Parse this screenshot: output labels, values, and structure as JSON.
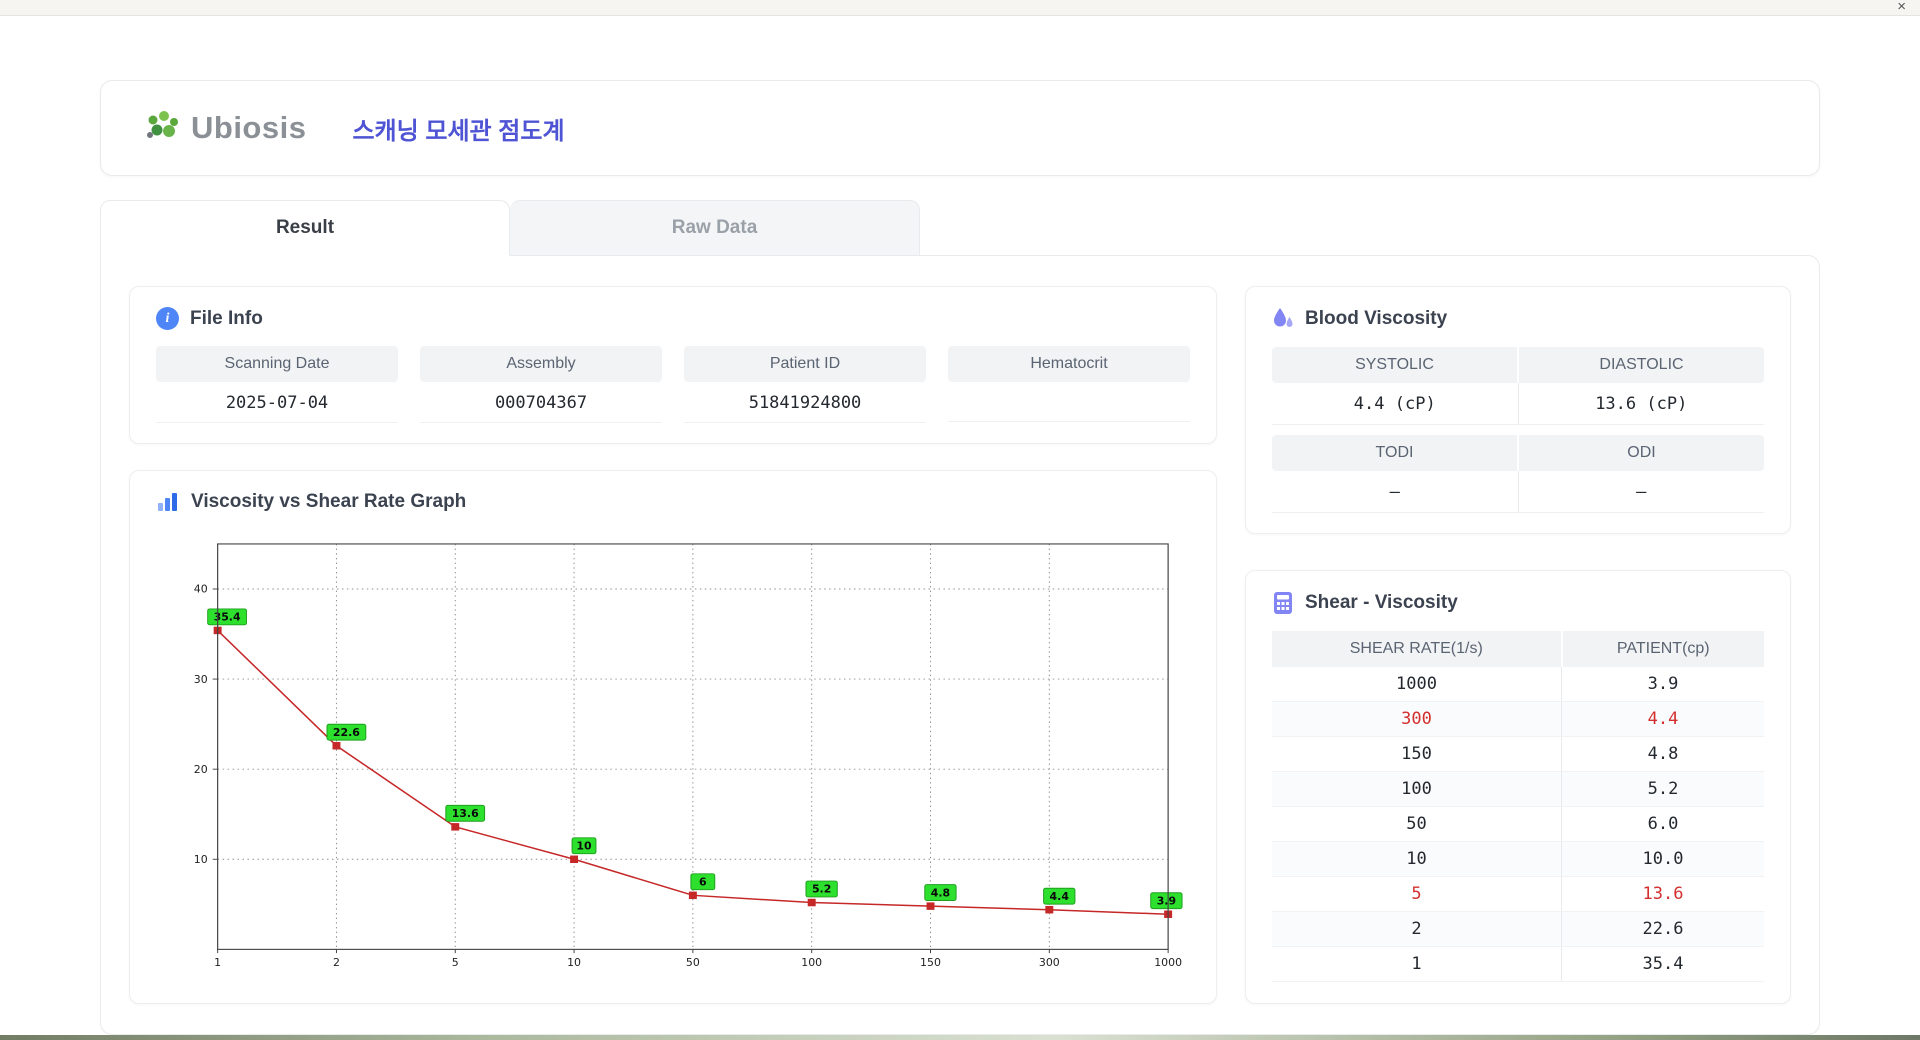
{
  "window": {
    "close_glyph": "×"
  },
  "header": {
    "logo_text": "Ubiosis",
    "title": "스캐닝 모세관 점도계"
  },
  "tabs": [
    {
      "label": "Result"
    },
    {
      "label": "Raw Data"
    }
  ],
  "icons": {
    "info_glyph": "i"
  },
  "colors": {
    "title_blue": "#4e54d4",
    "icon_blue": "#4f86f7",
    "icon_indigo": "#8285f4",
    "highlight_red": "#d32f2f",
    "chart_line_red": "#c62828",
    "chart_label_green": "#2ee02e",
    "header_gray": "#f1f3f5"
  },
  "file_info": {
    "title": "File Info",
    "fields": [
      {
        "label": "Scanning Date",
        "value": "2025-07-04"
      },
      {
        "label": "Assembly",
        "value": "000704367"
      },
      {
        "label": "Patient ID",
        "value": "51841924800"
      },
      {
        "label": "Hematocrit",
        "value": ""
      }
    ]
  },
  "blood_viscosity": {
    "title": "Blood Viscosity",
    "rows": [
      {
        "headers": [
          "SYSTOLIC",
          "DIASTOLIC"
        ],
        "values": [
          "4.4 (cP)",
          "13.6 (cP)"
        ]
      },
      {
        "headers": [
          "TODI",
          "ODI"
        ],
        "values": [
          "–",
          "–"
        ]
      }
    ]
  },
  "graph_section": {
    "title": "Viscosity vs Shear Rate Graph"
  },
  "chart_data": {
    "type": "line",
    "title": "Viscosity vs Shear Rate Graph",
    "x": [
      1,
      2,
      5,
      10,
      50,
      100,
      150,
      300,
      1000
    ],
    "x_tick_labels": [
      "1",
      "2",
      "5",
      "10",
      "50",
      "100",
      "150",
      "300",
      "1000"
    ],
    "x_axis_type": "equally-spaced-categories",
    "values": [
      35.4,
      22.6,
      13.6,
      10,
      6,
      5.2,
      4.8,
      4.4,
      3.9
    ],
    "point_labels": [
      "35.4",
      "22.6",
      "13.6",
      "10",
      "6",
      "5.2",
      "4.8",
      "4.4",
      "3.9"
    ],
    "xlabel": "",
    "ylabel": "",
    "ylim": [
      0,
      45
    ],
    "yticks": [
      10,
      20,
      30,
      40
    ],
    "grid": true,
    "legend": false,
    "line_color": "#c62828",
    "marker_color": "#c62828",
    "marker_shape": "square",
    "label_bg": "#2ee02e",
    "label_border": "#1f9e1f"
  },
  "shear_viscosity": {
    "title": "Shear - Viscosity",
    "columns": [
      "SHEAR RATE(1/s)",
      "PATIENT(cp)"
    ],
    "highlight_color": "#d32f2f",
    "rows": [
      {
        "shear": "1000",
        "patient": "3.9",
        "highlight": false
      },
      {
        "shear": "300",
        "patient": "4.4",
        "highlight": true
      },
      {
        "shear": "150",
        "patient": "4.8",
        "highlight": false
      },
      {
        "shear": "100",
        "patient": "5.2",
        "highlight": false
      },
      {
        "shear": "50",
        "patient": "6.0",
        "highlight": false
      },
      {
        "shear": "10",
        "patient": "10.0",
        "highlight": false
      },
      {
        "shear": "5",
        "patient": "13.6",
        "highlight": true
      },
      {
        "shear": "2",
        "patient": "22.6",
        "highlight": false
      },
      {
        "shear": "1",
        "patient": "35.4",
        "highlight": false
      }
    ]
  }
}
